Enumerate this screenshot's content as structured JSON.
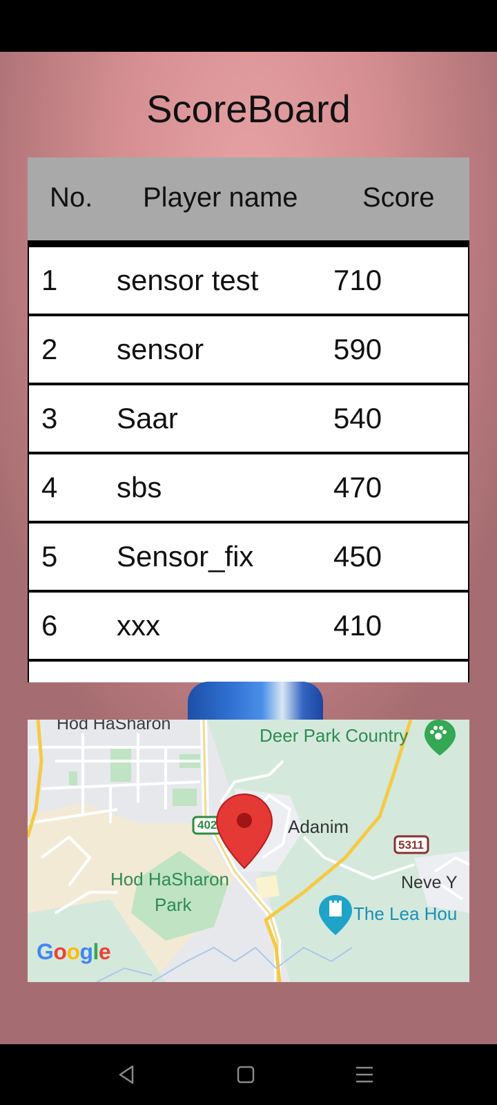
{
  "app": {
    "title": "ScoreBoard"
  },
  "table": {
    "headers": {
      "no": "No.",
      "name": "Player name",
      "score": "Score"
    },
    "rows": [
      {
        "no": "1",
        "name": "sensor test",
        "score": "710"
      },
      {
        "no": "2",
        "name": "sensor",
        "score": "590"
      },
      {
        "no": "3",
        "name": "Saar",
        "score": "540"
      },
      {
        "no": "4",
        "name": "sbs",
        "score": "470"
      },
      {
        "no": "5",
        "name": "Sensor_fix",
        "score": "450"
      },
      {
        "no": "6",
        "name": "xxx",
        "score": "410"
      }
    ]
  },
  "map": {
    "labels": {
      "hod_hasharon": "Hod HaSharon",
      "deer_park": "Deer Park Country",
      "adanim": "Adanim",
      "park_line1": "Hod HaSharon",
      "park_line2": "Park",
      "neve": "Neve Y",
      "lea": "The Lea Hou",
      "route_402": "402",
      "route_5311": "5311"
    },
    "google_logo": "Google",
    "pin_icon": "map-pin-icon",
    "park_icon": "paw-icon",
    "attraction_icon": "rook-icon",
    "colors": {
      "pin": "#e53935",
      "park_green": "#c7e6c9",
      "road_yellow": "#f6c945"
    }
  },
  "navbar": {
    "icons": [
      "back-triangle-icon",
      "home-square-icon",
      "menu-lines-icon"
    ]
  }
}
